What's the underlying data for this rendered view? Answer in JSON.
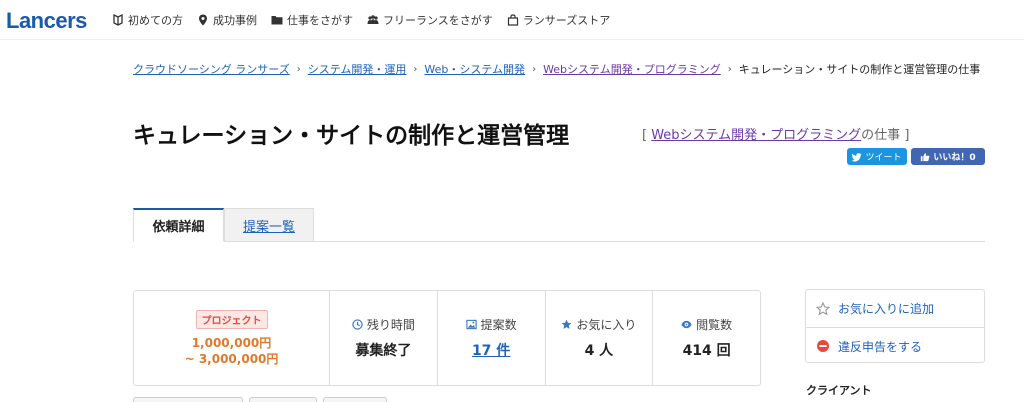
{
  "header": {
    "logo": "Lancers",
    "nav": [
      {
        "label": "初めての方",
        "icon": "beginner-mark-icon"
      },
      {
        "label": "成功事例",
        "icon": "map-pin-icon"
      },
      {
        "label": "仕事をさがす",
        "icon": "folder-icon"
      },
      {
        "label": "フリーランスをさがす",
        "icon": "people-icon"
      },
      {
        "label": "ランサーズストア",
        "icon": "store-bag-icon"
      }
    ]
  },
  "breadcrumb": [
    {
      "label": "クラウドソーシング ランサーズ"
    },
    {
      "label": "システム開発・運用"
    },
    {
      "label": "Web・システム開発"
    },
    {
      "label": "Webシステム開発・プログラミング"
    },
    {
      "label": "キュレーション・サイトの制作と運営管理の仕事"
    }
  ],
  "title": "キュレーション・サイトの制作と運営管理",
  "category": {
    "open": "[",
    "link": "Webシステム開発・プログラミング",
    "suffix": "の仕事",
    "close": "]"
  },
  "social": {
    "tweet": "ツイート",
    "like": "いいね！0"
  },
  "tabs": {
    "detail": "依頼詳細",
    "proposals": "提案一覧"
  },
  "stats": {
    "badge": "プロジェクト",
    "price_min": "1,000,000円",
    "price_max": "~ 3,000,000円",
    "remaining_label": "残り時間",
    "remaining_value": "募集終了",
    "proposals_label": "提案数",
    "proposals_value": "17 件",
    "favorites_label": "お気に入り",
    "favorites_value": "4 人",
    "views_label": "閲覧数",
    "views_value": "414 回"
  },
  "side": {
    "favorite": "お気に入りに追加",
    "report": "違反申告をする",
    "client_label": "クライアント"
  },
  "colors": {
    "brand": "#1a5aa8",
    "link": "#1f63b5",
    "visited": "#6a3aa8",
    "price": "#e07a2a",
    "badge": "#e04b3f",
    "twitter": "#1b95e0",
    "facebook": "#4267b2"
  }
}
